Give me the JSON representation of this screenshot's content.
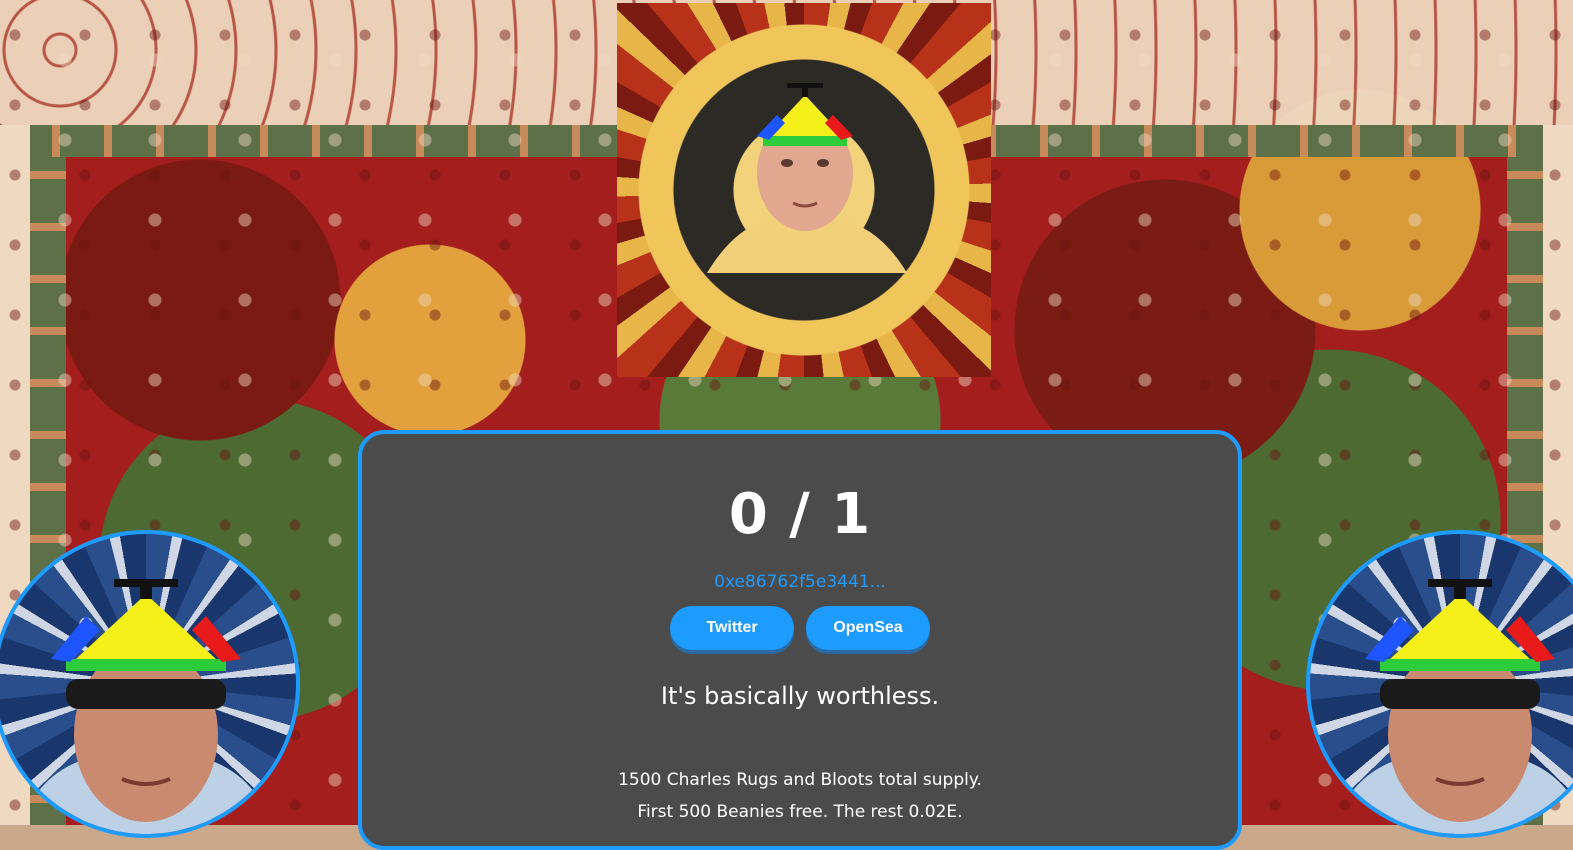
{
  "colors": {
    "accent": "#1e9bff",
    "panel_bg": "#4b4b4b",
    "text": "#ffffff"
  },
  "hero": {
    "image": "charles-rug-with-beanie-portrait"
  },
  "avatars": {
    "left": "charles-sunglasses-beanie-portrait",
    "right": "charles-sunglasses-beanie-portrait"
  },
  "mint": {
    "count": "0 / 1",
    "wallet_address": "0xe86762f5e3441...",
    "buttons": {
      "twitter": "Twitter",
      "opensea": "OpenSea"
    },
    "tagline": "It's basically worthless.",
    "info_lines": [
      "1500 Charles Rugs and Bloots total supply.",
      "First 500 Beanies free. The rest 0.02E."
    ]
  }
}
